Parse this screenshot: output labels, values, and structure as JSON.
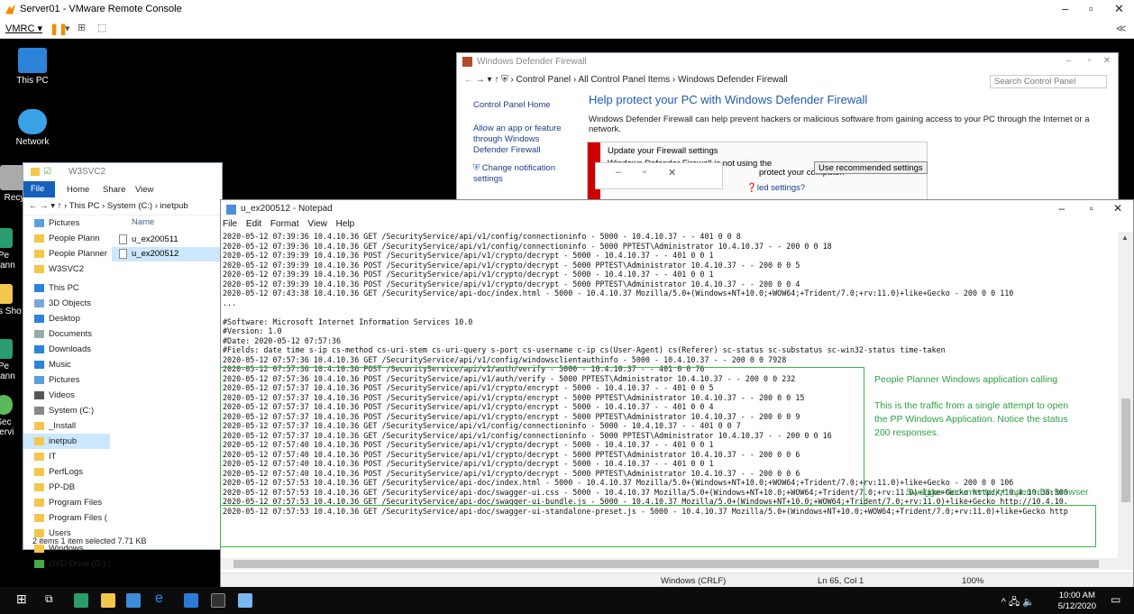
{
  "vmrc": {
    "title": "Server01 - VMware Remote Console",
    "menu_label": "VMRC ▾",
    "collapse_glyph": "≪",
    "min_glyph": "–",
    "max_glyph": "▫",
    "close_glyph": "✕"
  },
  "desktop_icons": [
    {
      "label": "This PC"
    },
    {
      "label": "Network"
    },
    {
      "label": "Recy"
    },
    {
      "label": "Pe Plann"
    },
    {
      "label": "_Ins Sho"
    },
    {
      "label": "Pe Plann"
    },
    {
      "label": "Sec Servi"
    }
  ],
  "firewall": {
    "title": "Windows Defender Firewall",
    "breadcrumb": "→  ▾  ↑  ⛨ › Control Panel › All Control Panel Items › Windows Defender Firewall",
    "search_placeholder": "Search Control Panel",
    "left_links": [
      "Control Panel Home",
      "Allow an app or feature through Windows Defender Firewall",
      "Change notification settings"
    ],
    "heading": "Help protect your PC with Windows Defender Firewall",
    "description": "Windows Defender Firewall can help prevent hackers or malicious software from gaining access to your PC through the Internet or a network.",
    "panel_title": "Update your Firewall settings",
    "panel_text": "Windows Defender Firewall is not using the",
    "panel_text2": "protect your computer.",
    "panel_link": "led settings?",
    "recommended_button": "Use recommended settings"
  },
  "explorer": {
    "title": "W3SVC2",
    "menu": {
      "file": "File",
      "home": "Home",
      "share": "Share",
      "view": "View"
    },
    "path": "←  →  ▾  ↑  › This PC › System (C:) › inetpub",
    "nav": [
      {
        "label": "Pictures",
        "selected": false
      },
      {
        "label": "People Plann",
        "selected": false
      },
      {
        "label": "People Planner 4",
        "selected": false
      },
      {
        "label": "W3SVC2",
        "selected": false
      },
      {
        "label": "This PC",
        "selected": false
      },
      {
        "label": "3D Objects",
        "selected": false
      },
      {
        "label": "Desktop",
        "selected": false
      },
      {
        "label": "Documents",
        "selected": false
      },
      {
        "label": "Downloads",
        "selected": false
      },
      {
        "label": "Music",
        "selected": false
      },
      {
        "label": "Pictures",
        "selected": false
      },
      {
        "label": "Videos",
        "selected": false
      },
      {
        "label": "System (C:)",
        "selected": false
      },
      {
        "label": "_Install",
        "selected": false
      },
      {
        "label": "inetpub",
        "selected": true
      },
      {
        "label": "IT",
        "selected": false
      },
      {
        "label": "PerfLogs",
        "selected": false
      },
      {
        "label": "PP-DB",
        "selected": false
      },
      {
        "label": "Program Files",
        "selected": false
      },
      {
        "label": "Program Files (",
        "selected": false
      },
      {
        "label": "Users",
        "selected": false
      },
      {
        "label": "Windows",
        "selected": false
      },
      {
        "label": "DVD Drive (D:) S",
        "selected": false
      }
    ],
    "files_header": "Name",
    "files": [
      {
        "name": "u_ex200511",
        "selected": false
      },
      {
        "name": "u_ex200512",
        "selected": true
      }
    ],
    "status": "2 items    1 item selected  7.71 KB"
  },
  "notepad": {
    "title": "u_ex200512 - Notepad",
    "menu": [
      "File",
      "Edit",
      "Format",
      "View",
      "Help"
    ],
    "lines": [
      "2020-05-12 07:39:36 10.4.10.36 GET /SecurityService/api/v1/config/connectioninfo - 5000 - 10.4.10.37 - - 401 0 0 8",
      "2020-05-12 07:39:36 10.4.10.36 GET /SecurityService/api/v1/config/connectioninfo - 5000 PPTEST\\Administrator 10.4.10.37 - - 200 0 0 18",
      "2020-05-12 07:39:39 10.4.10.36 POST /SecurityService/api/v1/crypto/decrypt - 5000 - 10.4.10.37 - - 401 0 0 1",
      "2020-05-12 07:39:39 10.4.10.36 POST /SecurityService/api/v1/crypto/decrypt - 5000 PPTEST\\Administrator 10.4.10.37 - - 200 0 0 5",
      "2020-05-12 07:39:39 10.4.10.36 POST /SecurityService/api/v1/crypto/decrypt - 5000 - 10.4.10.37 - - 401 0 0 1",
      "2020-05-12 07:39:39 10.4.10.36 POST /SecurityService/api/v1/crypto/decrypt - 5000 PPTEST\\Administrator 10.4.10.37 - - 200 0 0 4",
      "2020-05-12 07:43:38 10.4.10.36 GET /SecurityService/api-doc/index.html - 5000 - 10.4.10.37 Mozilla/5.0+(Windows+NT+10.0;+WOW64;+Trident/7.0;+rv:11.0)+like+Gecko - 200 0 0 110",
      "...",
      "",
      "#Software: Microsoft Internet Information Services 10.0",
      "#Version: 1.0",
      "#Date: 2020-05-12 07:57:36",
      "#Fields: date time s-ip cs-method cs-uri-stem cs-uri-query s-port cs-username c-ip cs(User-Agent) cs(Referer) sc-status sc-substatus sc-win32-status time-taken",
      "2020-05-12 07:57:36 10.4.10.36 GET /SecurityService/api/v1/config/windowsclientauthinfo - 5000 - 10.4.10.37 - - 200 0 0 7928",
      "2020-05-12 07:57:36 10.4.10.36 POST /SecurityService/api/v1/auth/verify - 5000 - 10.4.10.37 - - 401 0 0 76",
      "2020-05-12 07:57:36 10.4.10.36 POST /SecurityService/api/v1/auth/verify - 5000 PPTEST\\Administrator 10.4.10.37 - - 200 0 0 232",
      "2020-05-12 07:57:37 10.4.10.36 POST /SecurityService/api/v1/crypto/encrypt - 5000 - 10.4.10.37 - - 401 0 0 5",
      "2020-05-12 07:57:37 10.4.10.36 POST /SecurityService/api/v1/crypto/encrypt - 5000 PPTEST\\Administrator 10.4.10.37 - - 200 0 0 15",
      "2020-05-12 07:57:37 10.4.10.36 POST /SecurityService/api/v1/crypto/encrypt - 5000 - 10.4.10.37 - - 401 0 0 4",
      "2020-05-12 07:57:37 10.4.10.36 POST /SecurityService/api/v1/crypto/encrypt - 5000 PPTEST\\Administrator 10.4.10.37 - - 200 0 0 9",
      "2020-05-12 07:57:37 10.4.10.36 GET /SecurityService/api/v1/config/connectioninfo - 5000 - 10.4.10.37 - - 401 0 0 7",
      "2020-05-12 07:57:37 10.4.10.36 GET /SecurityService/api/v1/config/connectioninfo - 5000 PPTEST\\Administrator 10.4.10.37 - - 200 0 0 16",
      "2020-05-12 07:57:40 10.4.10.36 POST /SecurityService/api/v1/crypto/decrypt - 5000 - 10.4.10.37 - - 401 0 0 1",
      "2020-05-12 07:57:40 10.4.10.36 POST /SecurityService/api/v1/crypto/decrypt - 5000 PPTEST\\Administrator 10.4.10.37 - - 200 0 0 6",
      "2020-05-12 07:57:40 10.4.10.36 POST /SecurityService/api/v1/crypto/decrypt - 5000 - 10.4.10.37 - - 401 0 0 1",
      "2020-05-12 07:57:40 10.4.10.36 POST /SecurityService/api/v1/crypto/decrypt - 5000 PPTEST\\Administrator 10.4.10.37 - - 200 0 0 6",
      "2020-05-12 07:57:53 10.4.10.36 GET /SecurityService/api-doc/index.html - 5000 - 10.4.10.37 Mozilla/5.0+(Windows+NT+10.0;+WOW64;+Trident/7.0;+rv:11.0)+like+Gecko - 200 0 0 106",
      "2020-05-12 07:57:53 10.4.10.36 GET /SecurityService/api-doc/swagger-ui.css - 5000 - 10.4.10.37 Mozilla/5.0+(Windows+NT+10.0;+WOW64;+Trident/7.0;+rv:11.0)+like+Gecko http://10.4.10.36:500",
      "2020-05-12 07:57:53 10.4.10.36 GET /SecurityService/api-doc/swagger-ui-bundle.js - 5000 - 10.4.10.37 Mozilla/5.0+(Windows+NT+10.0;+WOW64;+Trident/7.0;+rv:11.0)+like+Gecko http://10.4.10.",
      "2020-05-12 07:57:53 10.4.10.36 GET /SecurityService/api-doc/swagger-ui-standalone-preset.js - 5000 - 10.4.10.37 Mozilla/5.0+(Windows+NT+10.0;+WOW64;+Trident/7.0;+rv:11.0)+like+Gecko http"
    ],
    "status": {
      "encoding": "Windows (CRLF)",
      "position": "Ln 65, Col 1",
      "zoom": "100%"
    },
    "annotations": {
      "heading": "People Planner Windows application calling",
      "body": "This is the traffic from a single attempt to open the PP Windows Application. Notice the status 200 responses.",
      "swagger": "Swagger documentation opened in browser"
    }
  },
  "taskbar": {
    "time": "10:00 AM",
    "date": "5/12/2020",
    "tray": "^ 🖧 🔈"
  },
  "colors": {
    "annotation_green": "#3bb54a",
    "firewall_heading": "#1c5ab0",
    "firewall_alert": "#cc0000"
  }
}
